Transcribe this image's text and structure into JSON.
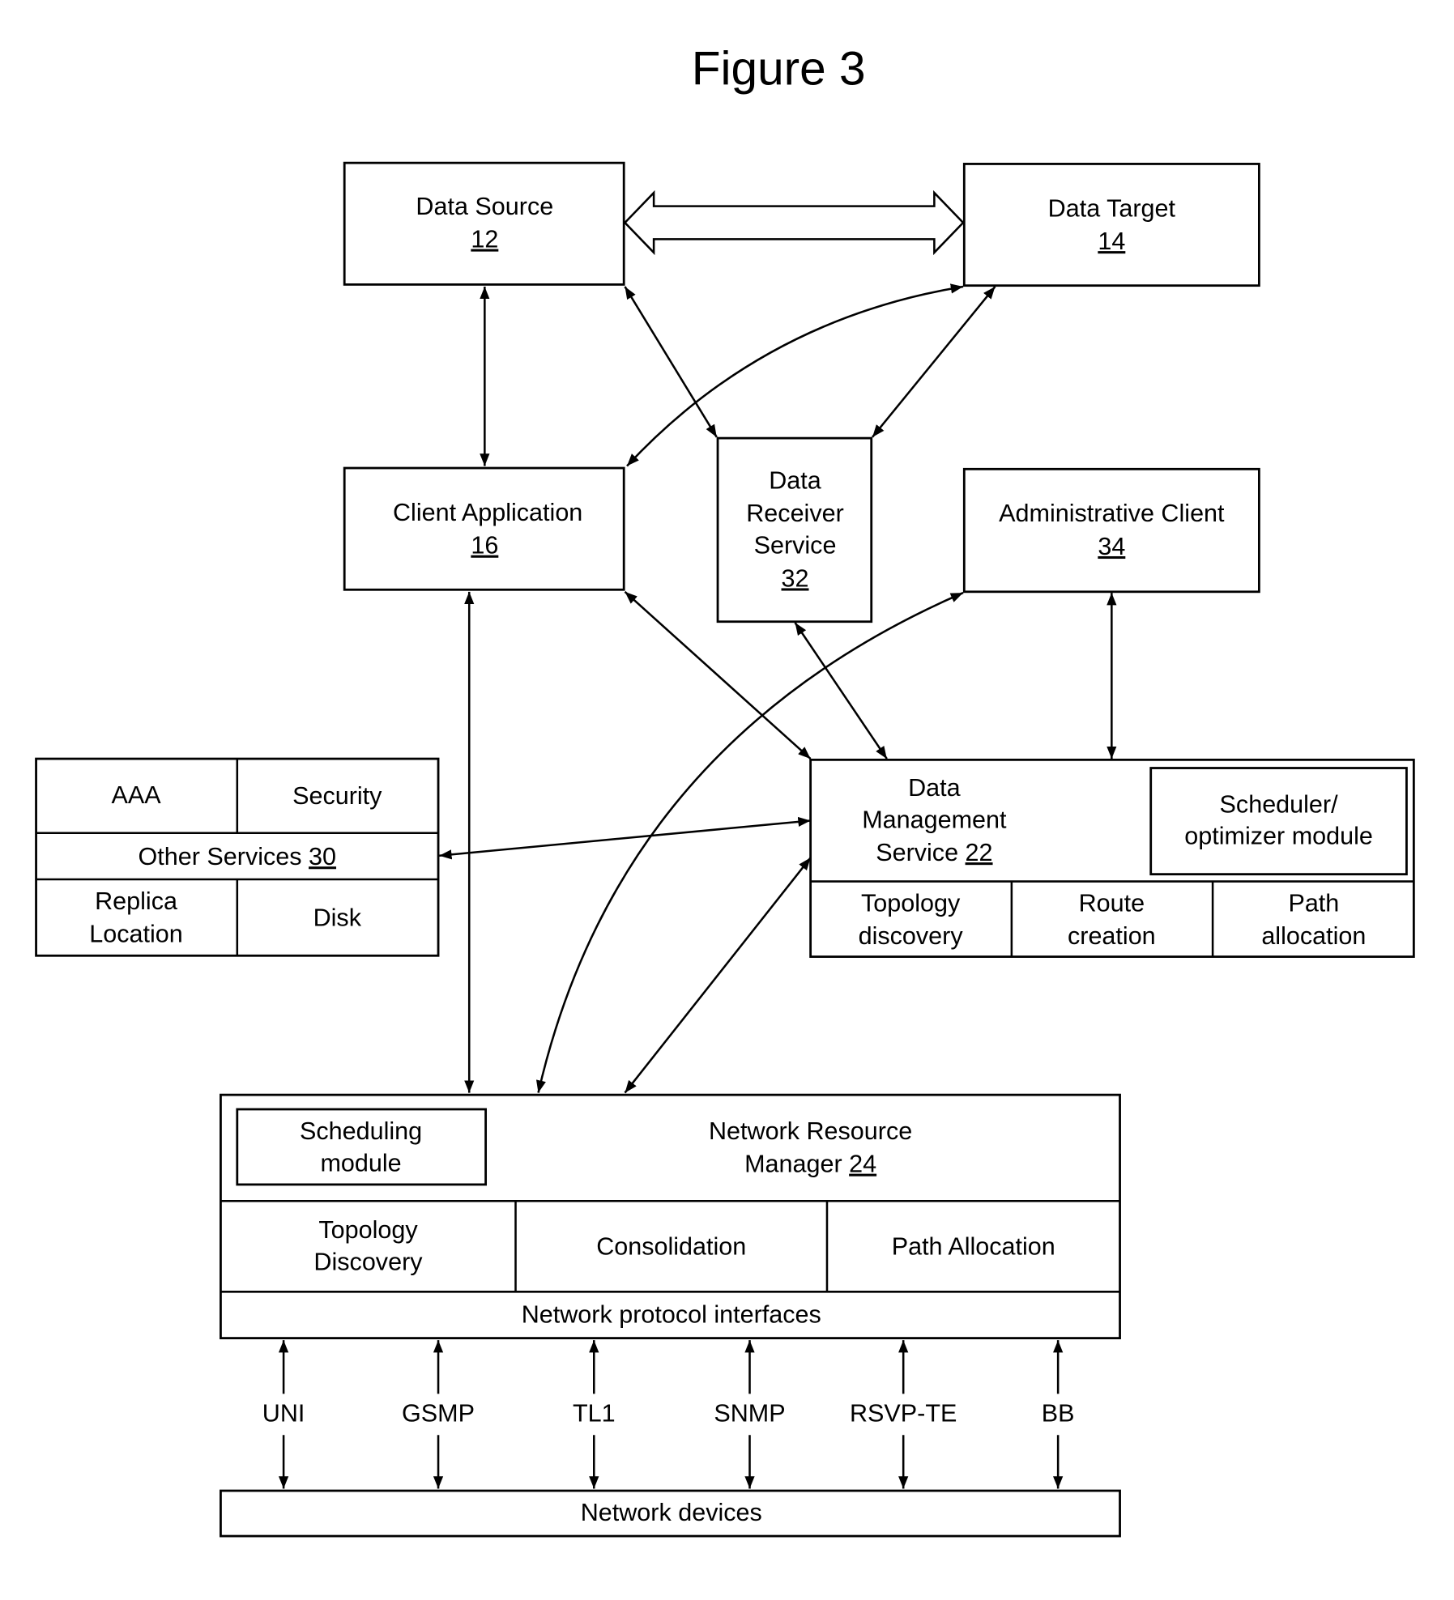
{
  "figure": {
    "title": "Figure 3"
  },
  "blocks": {
    "data_source": {
      "label": "Data Source",
      "ref": "12"
    },
    "data_target": {
      "label": "Data Target",
      "ref": "14"
    },
    "client_application": {
      "label": "Client Application",
      "ref": "16"
    },
    "data_receiver_service": {
      "lines": [
        "Data",
        "Receiver",
        "Service"
      ],
      "ref": "32"
    },
    "administrative_client": {
      "label": "Administrative Client",
      "ref": "34"
    },
    "other_services": {
      "aaa": "AAA",
      "security": "Security",
      "label": "Other Services",
      "ref": "30",
      "replica_location": [
        "Replica",
        "Location"
      ],
      "disk": "Disk"
    },
    "data_management_service": {
      "lines": [
        "Data",
        "Management",
        "Service"
      ],
      "ref": "22",
      "scheduler": [
        "Scheduler/",
        "optimizer module"
      ],
      "topology_discovery": [
        "Topology",
        "discovery"
      ],
      "route_creation": [
        "Route",
        "creation"
      ],
      "path_allocation": [
        "Path",
        "allocation"
      ]
    },
    "network_resource_manager": {
      "lines": [
        "Network Resource",
        "Manager"
      ],
      "ref": "24",
      "scheduling_module": [
        "Scheduling",
        "module"
      ],
      "topology_discovery": [
        "Topology",
        "Discovery"
      ],
      "consolidation": "Consolidation",
      "path_allocation": "Path Allocation",
      "protocol_interfaces": "Network protocol interfaces"
    },
    "network_devices": {
      "label": "Network devices"
    }
  },
  "protocols": [
    "UNI",
    "GSMP",
    "TL1",
    "SNMP",
    "RSVP-TE",
    "BB"
  ]
}
